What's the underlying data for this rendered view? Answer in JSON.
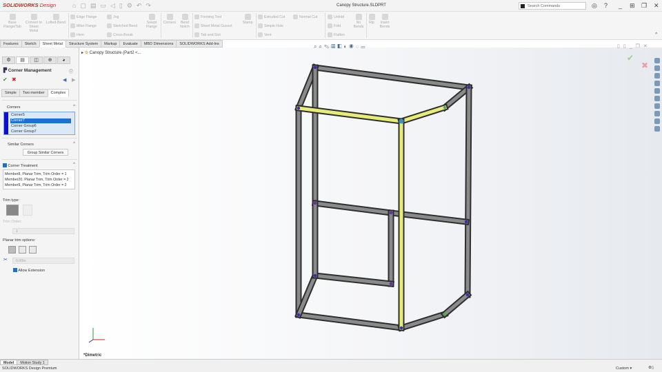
{
  "app": {
    "logo_brand": "SOLIDWORKS",
    "logo_suffix": "Design",
    "document_title": "Canopy Structure.SLDPRT",
    "search_placeholder": "Search Commands"
  },
  "ribbon": {
    "large": [
      {
        "label": "Base Flange/Tab"
      },
      {
        "label": "Convert to Sheet Metal"
      },
      {
        "label": "Lofted-Bend"
      },
      {
        "label": "Swept Flange"
      },
      {
        "label": "Corners"
      },
      {
        "label": "Bend Notch"
      },
      {
        "label": "Stamp"
      },
      {
        "label": "No Bends"
      },
      {
        "label": "Rip"
      },
      {
        "label": "Insert Bends"
      }
    ],
    "small": [
      {
        "label": "Edge Flange"
      },
      {
        "label": "Miter Flange"
      },
      {
        "label": "Hem"
      },
      {
        "label": "Jog"
      },
      {
        "label": "Sketched Bend"
      },
      {
        "label": "Cross-Break"
      },
      {
        "label": "Forming Tool"
      },
      {
        "label": "Sheet Metal Gusset"
      },
      {
        "label": "Tab and Slot"
      },
      {
        "label": "Extruded Cut"
      },
      {
        "label": "Simple Hole"
      },
      {
        "label": "Vent"
      },
      {
        "label": "Normal Cut"
      },
      {
        "label": "Unfold"
      },
      {
        "label": "Fold"
      },
      {
        "label": "Flatten"
      }
    ]
  },
  "tabs": [
    {
      "label": "Features"
    },
    {
      "label": "Sketch"
    },
    {
      "label": "Sheet Metal",
      "active": true
    },
    {
      "label": "Structure System"
    },
    {
      "label": "Markup"
    },
    {
      "label": "Evaluate"
    },
    {
      "label": "MBD Dimensions"
    },
    {
      "label": "SOLIDWORKS Add-Ins"
    }
  ],
  "tree": {
    "root": "Canopy Structure (Part2 <..."
  },
  "panel": {
    "title": "Corner Management",
    "subtabs": [
      {
        "label": "Simple"
      },
      {
        "label": "Two member"
      },
      {
        "label": "Complex",
        "active": true
      }
    ],
    "corners": {
      "heading": "Corners",
      "items": [
        {
          "label": "Corner5"
        },
        {
          "label": "Corner7",
          "selected": true
        },
        {
          "label": "Corner Group6"
        },
        {
          "label": "Corner Group7"
        }
      ]
    },
    "similar": {
      "heading": "Similar Corners",
      "button": "Group Similar Corners"
    },
    "treatment": {
      "heading": "Corner Treatment",
      "checked": true,
      "lines": [
        "Member8, Planar Trim, Trim Order = 1",
        "Member20, Planar Trim, Trim Order = 2",
        "Member9, Planar Trim, Trim Order = 2"
      ]
    },
    "trim_type_label": "Trim type:",
    "trim_order_label": "Trim Order:",
    "trim_order_value": "1",
    "planar_label": "Planar trim options:",
    "gap_value": "0.00in",
    "allow_extension": {
      "label": "Allow Extension",
      "checked": true
    }
  },
  "viewport": {
    "view_label": "*Dimetric",
    "accent_highlight": "#e6ec7a",
    "beam_color": "#8a8a8a"
  },
  "bottom_tabs": [
    {
      "label": "Model",
      "active": true
    },
    {
      "label": "Motion Study 1"
    }
  ],
  "status": {
    "left": "SOLIDWORKS Design Premium",
    "units": "Custom"
  }
}
